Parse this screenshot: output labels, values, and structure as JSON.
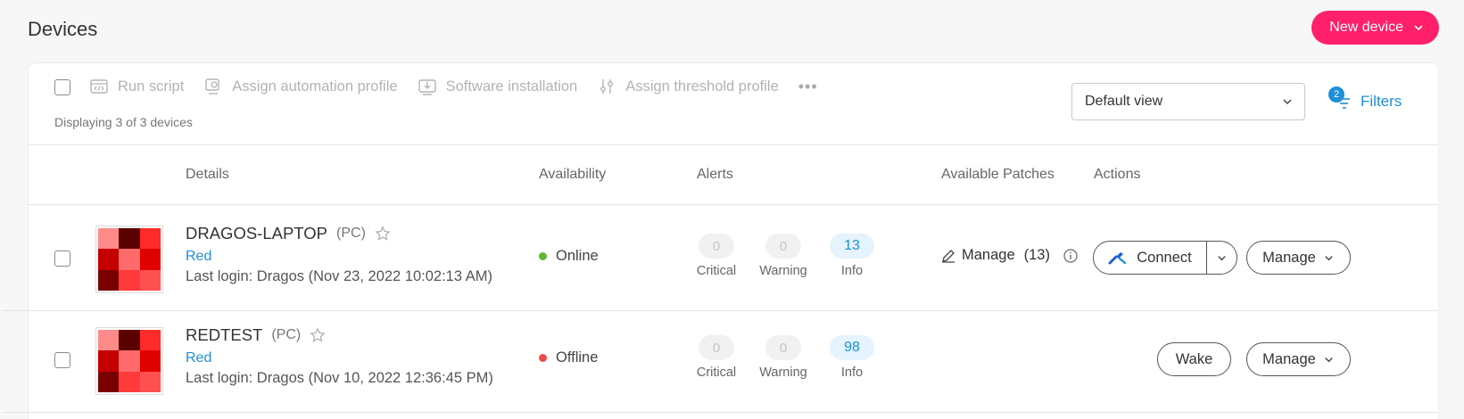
{
  "page": {
    "title": "Devices",
    "new_device_label": "New device"
  },
  "toolbar": {
    "actions": [
      {
        "label": "Run script",
        "icon": "script-icon"
      },
      {
        "label": "Assign automation profile",
        "icon": "automation-profile-icon"
      },
      {
        "label": "Software installation",
        "icon": "software-install-icon"
      },
      {
        "label": "Assign threshold profile",
        "icon": "threshold-icon"
      }
    ],
    "more_label": "•••",
    "displaying": "Displaying 3 of 3 devices",
    "view_select": "Default view",
    "filters_label": "Filters",
    "filters_count": "2"
  },
  "columns": {
    "details": "Details",
    "availability": "Availability",
    "alerts": "Alerts",
    "patches": "Available Patches",
    "actions": "Actions"
  },
  "devices": [
    {
      "name": "DRAGOS-LAPTOP",
      "type": "(PC)",
      "org": "Red",
      "last_login": "Last login: Dragos (Nov 23, 2022 10:02:13 AM)",
      "availability": "Online",
      "availability_color": "#5bb834",
      "alerts": {
        "critical": "0",
        "critical_label": "Critical",
        "warning": "0",
        "warning_label": "Warning",
        "info": "13",
        "info_label": "Info"
      },
      "patches_label": "Manage",
      "patches_count": "(13)",
      "primary_action": "Connect",
      "manage_label": "Manage"
    },
    {
      "name": "REDTEST",
      "type": "(PC)",
      "org": "Red",
      "last_login": "Last login: Dragos (Nov 10, 2022 12:36:45 PM)",
      "availability": "Offline",
      "availability_color": "#ef4b4b",
      "alerts": {
        "critical": "0",
        "critical_label": "Critical",
        "warning": "0",
        "warning_label": "Warning",
        "info": "98",
        "info_label": "Info"
      },
      "primary_action": "Wake",
      "manage_label": "Manage"
    }
  ],
  "colors": {
    "accent": "#ff1f6a",
    "link": "#1e8fd8",
    "thumb": [
      "#ff8a8a",
      "#5a0000",
      "#ff2a2a",
      "#c40000",
      "#ff6a6a",
      "#e00000",
      "#7a0000",
      "#ff3a3a",
      "#ff5050"
    ]
  }
}
